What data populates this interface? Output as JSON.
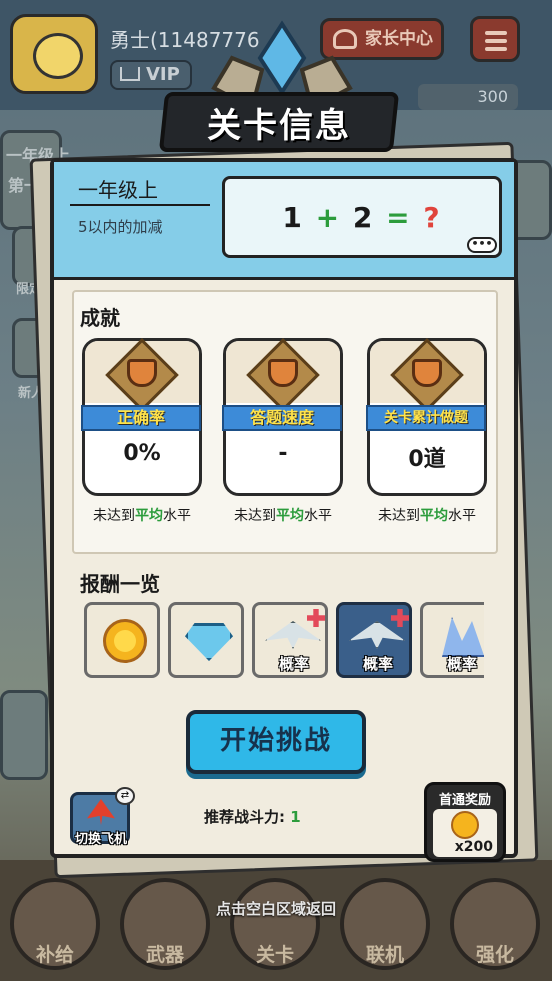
{
  "header": {
    "player_name": "勇士(11487776",
    "vip_label": "VIP",
    "parent_center_label": "家长中心",
    "gem_count": "300"
  },
  "background": {
    "side_labels": [
      "一年级上",
      "第一",
      "限定",
      "新人"
    ]
  },
  "dialog": {
    "title": "关卡信息",
    "grade": "一年级上",
    "topic": "5以内的加减",
    "example": {
      "a": "1",
      "op": "+",
      "b": "2",
      "eq": "=",
      "q": "?"
    },
    "more_label": "•••",
    "achievements_title": "成就",
    "achievements": [
      {
        "name": "正确率",
        "value": "0%",
        "note_prefix": "未达到",
        "note_avg": "平均",
        "note_suffix": "水平"
      },
      {
        "name": "答题速度",
        "value": "-",
        "note_prefix": "未达到",
        "note_avg": "平均",
        "note_suffix": "水平"
      },
      {
        "name": "关卡累计做题",
        "value": "0道",
        "note_prefix": "未达到",
        "note_avg": "平均",
        "note_suffix": "水平"
      }
    ],
    "rewards_title": "报酬一览",
    "rewards": [
      {
        "icon": "coin-icon",
        "label": ""
      },
      {
        "icon": "diamond-icon",
        "label": ""
      },
      {
        "icon": "plane-icon",
        "label": "概率"
      },
      {
        "icon": "plane-icon",
        "label": "概率",
        "selected": true
      },
      {
        "icon": "crystal-icon",
        "label": "概率"
      }
    ],
    "start_button_label": "开始挑战",
    "switch_plane_label": "切换飞机",
    "power_label": "推荐战斗力: ",
    "power_value": "1",
    "first_clear_title": "首通奖励",
    "first_clear_count": "x200"
  },
  "bottom_nav": [
    {
      "label": "补给"
    },
    {
      "label": "武器"
    },
    {
      "label": "关卡"
    },
    {
      "label": "联机"
    },
    {
      "label": "强化"
    }
  ],
  "dismiss_hint": "点击空白区域返回",
  "colors": {
    "accent_green": "#2c9c3c",
    "start_button": "#2fb8e8",
    "ribbon_blue": "#3d8bd8",
    "ribbon_text": "#ffe34a",
    "question_mark": "#e0443c"
  }
}
